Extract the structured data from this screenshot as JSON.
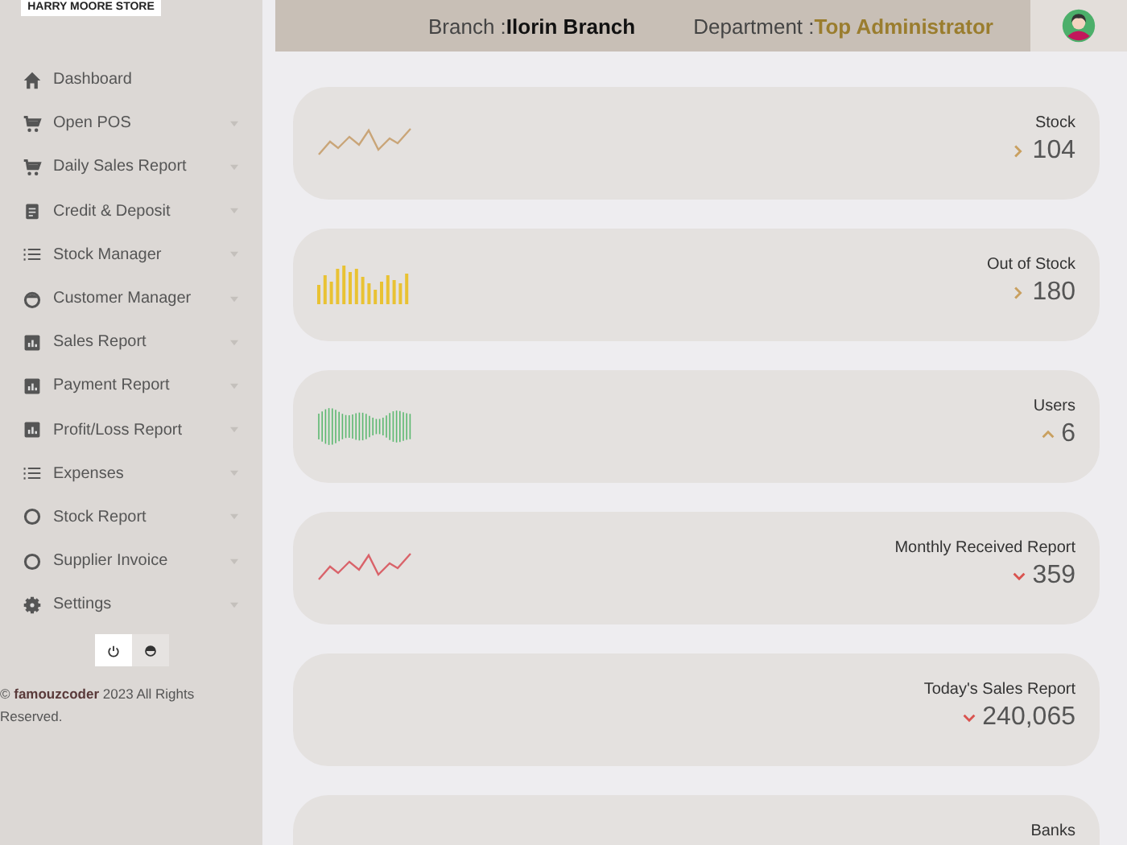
{
  "logo": {
    "text": "HARRY MOORE STORE"
  },
  "sidebar": {
    "items": [
      {
        "label": "Dashboard",
        "kind": "home",
        "has_caret": false
      },
      {
        "label": "Open POS",
        "kind": "cart",
        "has_caret": true
      },
      {
        "label": "Daily Sales Report",
        "kind": "cart",
        "has_caret": true
      },
      {
        "label": "Credit & Deposit",
        "kind": "clipboard",
        "has_caret": true
      },
      {
        "label": "Stock Manager",
        "kind": "list",
        "has_caret": true
      },
      {
        "label": "Customer Manager",
        "kind": "face",
        "has_caret": true
      },
      {
        "label": "Sales Report",
        "kind": "chart",
        "has_caret": true
      },
      {
        "label": "Payment Report",
        "kind": "chart",
        "has_caret": true
      },
      {
        "label": "Profit/Loss Report",
        "kind": "chart",
        "has_caret": true
      },
      {
        "label": "Expenses",
        "kind": "list",
        "has_caret": true
      },
      {
        "label": "Stock Report",
        "kind": "circle",
        "has_caret": true
      },
      {
        "label": "Supplier Invoice",
        "kind": "circle",
        "has_caret": true
      },
      {
        "label": "Settings",
        "kind": "gear",
        "has_caret": true
      }
    ],
    "footer": "© **famouzcoder** 2023 All Rights Reserved."
  },
  "header": {
    "branch_label": "Branch :",
    "branch": "Ilorin Branch",
    "department_label": "Department :",
    "department": "Top Administrator"
  },
  "cards": [
    {
      "title": "Stock",
      "value": "104",
      "trend": {
        "kind": "right",
        "color": "#c9a060"
      },
      "kind": "line",
      "color": "#c9a578"
    },
    {
      "title": "Out of Stock",
      "value": "180",
      "trend": {
        "kind": "right",
        "color": "#c9a060"
      },
      "kind": "bars",
      "color": "#e9c233"
    },
    {
      "title": "Users",
      "value": "6",
      "trend": {
        "kind": "up",
        "color": "#c9a060"
      },
      "kind": "thin-bars",
      "color": "#5cb870"
    },
    {
      "title": "Monthly Received Report",
      "value": "359",
      "trend": {
        "kind": "down",
        "color": "#d9534f"
      },
      "kind": "line",
      "color": "#d9636a"
    },
    {
      "title": "Today's Sales Report",
      "value": "240,065",
      "trend": {
        "kind": "down",
        "color": "#d9534f"
      },
      "kind": "none"
    },
    {
      "title": "Banks",
      "kind": "none"
    }
  ]
}
